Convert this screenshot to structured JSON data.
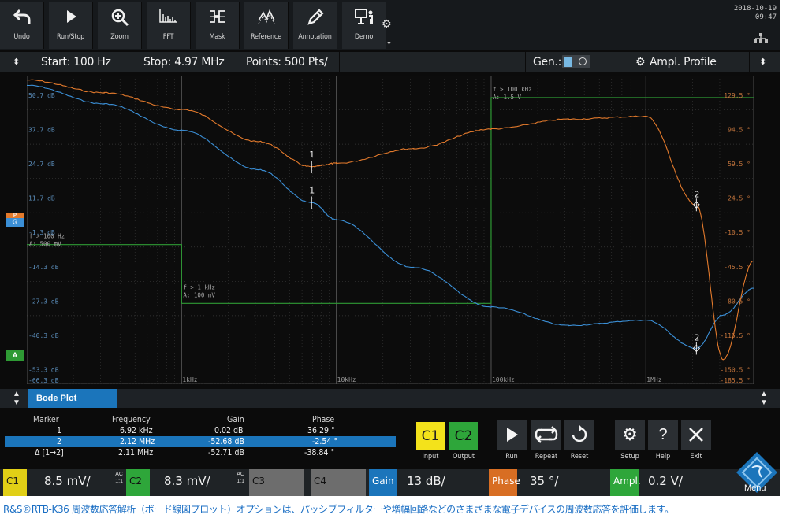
{
  "toolbar": {
    "buttons": [
      {
        "label": "Undo",
        "icon": "undo-icon"
      },
      {
        "label": "Run/Stop",
        "icon": "play-icon"
      },
      {
        "label": "Zoom",
        "icon": "zoom-icon"
      },
      {
        "label": "FFT",
        "icon": "fft-icon"
      },
      {
        "label": "Mask",
        "icon": "mask-icon"
      },
      {
        "label": "Reference",
        "icon": "reference-icon"
      },
      {
        "label": "Annotation",
        "icon": "pencil-icon"
      },
      {
        "label": "Demo",
        "icon": "demo-icon"
      }
    ],
    "more_icon": "gear-icon",
    "date": "2018-10-19",
    "time": "09:47"
  },
  "freq_bar": {
    "start": "Start: 100 Hz",
    "stop": "Stop: 4.97 MHz",
    "points": "Points: 500 Pts/",
    "gen_label": "Gen.:",
    "profile": "Ampl. Profile"
  },
  "plot": {
    "left_labels": [
      "50.7 dB",
      "37.7 dB",
      "24.7 dB",
      "11.7 dB",
      "-1.3 dB",
      "-14.3 dB",
      "-27.3 dB",
      "-40.3 dB",
      "-53.3 dB",
      "-66.3 dB"
    ],
    "right_labels": [
      "129.5 °",
      "94.5 °",
      "59.5 °",
      "24.5 °",
      "-10.5 °",
      "-45.5 °",
      "-80.5 °",
      "-115.5 °",
      "-150.5 °",
      "-185.5 °"
    ],
    "x_labels": [
      "1kHz",
      "10kHz",
      "100kHz",
      "1MHz"
    ],
    "profile_labels": [
      {
        "f": "f > 100 Hz",
        "a": "A: 500 mV"
      },
      {
        "f": "f > 1 kHz",
        "a": "A: 100 mV"
      },
      {
        "f": "f > 100 kHz",
        "a": "A: 1.5 V"
      }
    ],
    "marker1": "1",
    "marker2": "2",
    "ch_tags": {
      "gain": "G",
      "phase": "P",
      "ampl": "A"
    },
    "colors": {
      "gain": "#3b8fd6",
      "phase": "#e37a2c",
      "profile": "#2e9a34",
      "grid": "#3a3a3a"
    }
  },
  "chart_data": {
    "type": "line",
    "x": [
      100,
      316,
      1000,
      3162,
      6920,
      10000,
      31623,
      100000,
      316228,
      1000000,
      2120000,
      3162000,
      4970000
    ],
    "series": [
      {
        "values": [
          47,
          40,
          30,
          15,
          2.5,
          -4,
          -22,
          -37,
          -44,
          -42,
          -52.7,
          -40,
          -30
        ]
      },
      {
        "values": [
          125,
          112,
          95,
          62,
          36.3,
          40,
          55,
          75,
          85,
          88,
          -2.5,
          -160,
          -60
        ]
      }
    ],
    "ylim_gain": [
      -66.3,
      50.7
    ],
    "ylim_phase": [
      -185.5,
      129.5
    ],
    "xscale": "log",
    "xlim": [
      100,
      4970000
    ]
  },
  "bode": {
    "tab": "Bode Plot",
    "headers": {
      "marker": "Marker",
      "frequency": "Frequency",
      "gain": "Gain",
      "phase": "Phase"
    },
    "rows": [
      {
        "marker": "1",
        "frequency": "6.92 kHz",
        "gain": "0.02 dB",
        "phase": "36.29 °"
      },
      {
        "marker": "2",
        "frequency": "2.12 MHz",
        "gain": "-52.68 dB",
        "phase": "-2.54 °"
      },
      {
        "marker": "Δ [1→2]",
        "frequency": "2.11 MHz",
        "gain": "-52.71 dB",
        "phase": "-38.84 °"
      }
    ],
    "controls": {
      "c1": "C1",
      "c2": "C2",
      "input": "Input",
      "output": "Output",
      "run": "Run",
      "repeat": "Repeat",
      "reset": "Reset",
      "setup": "Setup",
      "help": "Help",
      "exit": "Exit"
    }
  },
  "status": {
    "c1": "C1",
    "c1_val": "8.5 mV/",
    "c1_ac": "AC",
    "c1_ratio": "1:1",
    "c2": "C2",
    "c2_val": "8.3 mV/",
    "c2_ac": "AC",
    "c2_ratio": "1:1",
    "c3": "C3",
    "c4": "C4",
    "gain": "Gain",
    "gain_val": "13 dB/",
    "phase": "Phase",
    "phase_val": "35 °/",
    "ampl": "Ampl.",
    "ampl_val": "0.2 V/",
    "menu": "Menu"
  },
  "caption": "R&S®RTB-K36 周波数応答解析（ボード線図プロット）オプションは、パッシブフィルターや増幅回路などのさまざまな電子デバイスの周波数応答を評価します。"
}
